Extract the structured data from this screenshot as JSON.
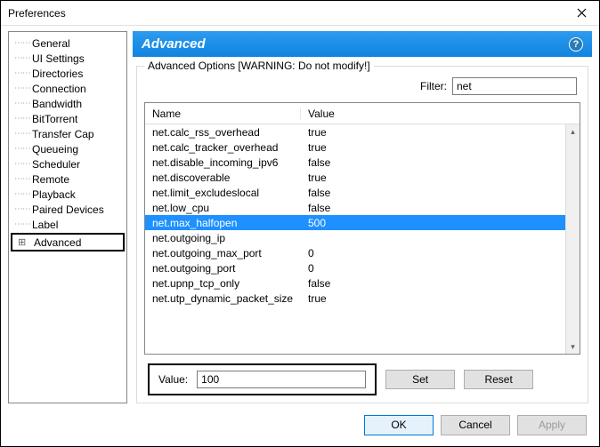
{
  "window": {
    "title": "Preferences"
  },
  "sidebar": {
    "items": [
      {
        "label": "General"
      },
      {
        "label": "UI Settings"
      },
      {
        "label": "Directories"
      },
      {
        "label": "Connection"
      },
      {
        "label": "Bandwidth"
      },
      {
        "label": "BitTorrent"
      },
      {
        "label": "Transfer Cap"
      },
      {
        "label": "Queueing"
      },
      {
        "label": "Scheduler"
      },
      {
        "label": "Remote"
      },
      {
        "label": "Playback"
      },
      {
        "label": "Paired Devices"
      },
      {
        "label": "Label"
      },
      {
        "label": "Advanced",
        "expandable": true,
        "selected": true
      }
    ]
  },
  "panel": {
    "title": "Advanced",
    "group_label": "Advanced Options [WARNING: Do not modify!]",
    "filter_label": "Filter:",
    "filter_value": "net",
    "columns": {
      "name": "Name",
      "value": "Value"
    },
    "rows": [
      {
        "name": "net.calc_rss_overhead",
        "value": "true"
      },
      {
        "name": "net.calc_tracker_overhead",
        "value": "true"
      },
      {
        "name": "net.disable_incoming_ipv6",
        "value": "false"
      },
      {
        "name": "net.discoverable",
        "value": "true"
      },
      {
        "name": "net.limit_excludeslocal",
        "value": "false"
      },
      {
        "name": "net.low_cpu",
        "value": "false"
      },
      {
        "name": "net.max_halfopen",
        "value": "500",
        "selected": true
      },
      {
        "name": "net.outgoing_ip",
        "value": ""
      },
      {
        "name": "net.outgoing_max_port",
        "value": "0"
      },
      {
        "name": "net.outgoing_port",
        "value": "0"
      },
      {
        "name": "net.upnp_tcp_only",
        "value": "false"
      },
      {
        "name": "net.utp_dynamic_packet_size",
        "value": "true"
      }
    ],
    "value_label": "Value:",
    "value_input": "100",
    "set_label": "Set",
    "reset_label": "Reset"
  },
  "footer": {
    "ok": "OK",
    "cancel": "Cancel",
    "apply": "Apply"
  }
}
